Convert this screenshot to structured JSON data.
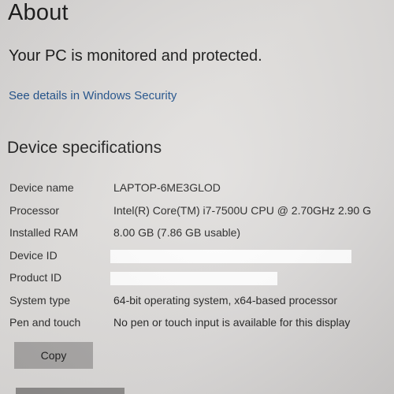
{
  "page": {
    "title": "About",
    "status_message": "Your PC is monitored and protected.",
    "security_link": "See details in Windows Security"
  },
  "device_specifications": {
    "heading": "Device specifications",
    "rows": [
      {
        "label": "Device name",
        "value": "LAPTOP-6ME3GLOD"
      },
      {
        "label": "Processor",
        "value": "Intel(R) Core(TM) i7-7500U CPU @ 2.70GHz   2.90 G"
      },
      {
        "label": "Installed RAM",
        "value": "8.00 GB (7.86 GB usable)"
      },
      {
        "label": "Device ID",
        "value": ""
      },
      {
        "label": "Product ID",
        "value": ""
      },
      {
        "label": "System type",
        "value": "64-bit operating system, x64-based processor"
      },
      {
        "label": "Pen and touch",
        "value": "No pen or touch input is available for this display"
      }
    ],
    "copy_label": "Copy"
  },
  "colors": {
    "link": "#1d4f8a",
    "button_bg": "#a9a7a6",
    "redaction": "#ffffff"
  }
}
